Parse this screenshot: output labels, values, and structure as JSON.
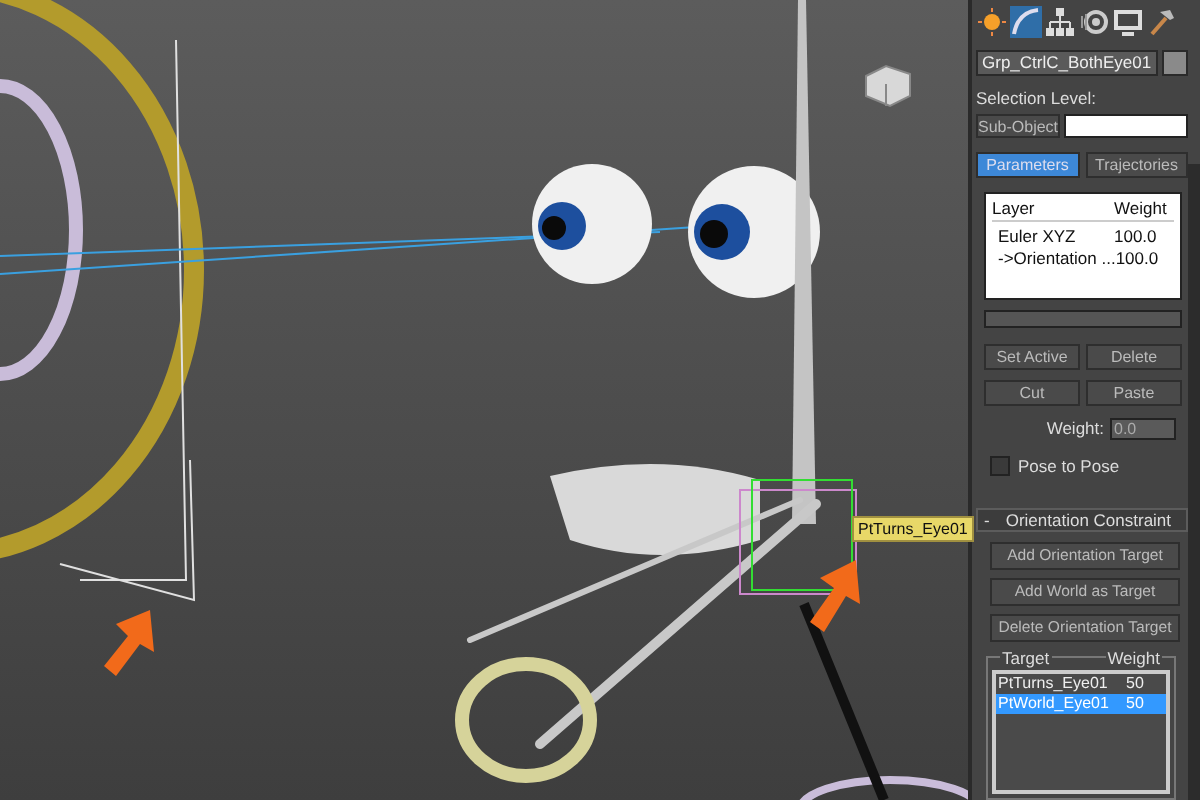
{
  "viewport": {
    "tooltip": "PtTurns_Eye01"
  },
  "command_panel": {
    "object_name": "Grp_CtrlC_BothEye01",
    "selection_level_label": "Selection Level:",
    "sub_object_button": "Sub-Object",
    "mode_tabs": [
      {
        "label": "Parameters",
        "selected": true
      },
      {
        "label": "Trajectories",
        "selected": false
      }
    ],
    "layer_list": {
      "columns": [
        "Layer",
        "Weight"
      ],
      "rows": [
        {
          "layer": "Euler XYZ",
          "weight": "100.0"
        },
        {
          "layer": "->Orientation ...",
          "weight": "100.0"
        }
      ]
    },
    "layer_buttons": [
      "Set Active",
      "Delete",
      "Cut",
      "Paste"
    ],
    "weight": {
      "label": "Weight:",
      "value": "0.0"
    },
    "pose_to_pose": {
      "label": "Pose to Pose",
      "checked": false
    },
    "rollout": {
      "toggle": "-",
      "title": "Orientation Constraint"
    },
    "constraint_buttons": [
      "Add Orientation Target",
      "Add World as Target",
      "Delete Orientation Target"
    ],
    "target_list": {
      "columns": [
        "Target",
        "Weight"
      ],
      "rows": [
        {
          "target": "PtTurns_Eye01",
          "weight": "50",
          "selected": false
        },
        {
          "target": "PtWorld_Eye01",
          "weight": "50",
          "selected": true
        }
      ]
    }
  }
}
